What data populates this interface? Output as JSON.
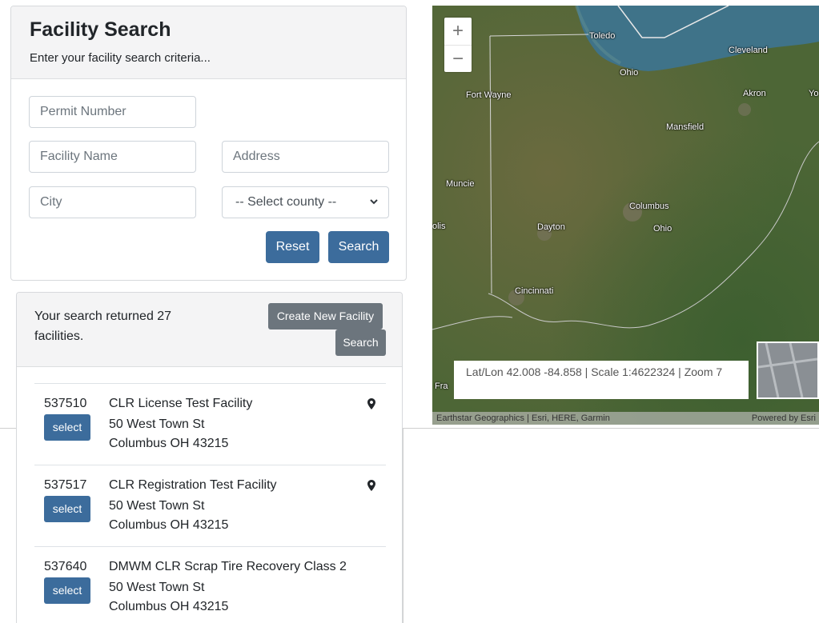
{
  "search": {
    "title": "Facility Search",
    "subtitle": "Enter your facility search criteria...",
    "permit_placeholder": "Permit Number",
    "name_placeholder": "Facility Name",
    "address_placeholder": "Address",
    "city_placeholder": "City",
    "county_selected": "-- Select county --",
    "reset_label": "Reset",
    "search_label": "Search"
  },
  "results": {
    "count_text": "Your search returned 27 facilities.",
    "create_label": "Create New Facility",
    "search_label": "Search",
    "select_label": "select",
    "rows": [
      {
        "permit": "537510",
        "name": "CLR License Test Facility",
        "address": "50 West Town St",
        "city": "Columbus OH 43215",
        "has_pin": true
      },
      {
        "permit": "537517",
        "name": "CLR Registration Test Facility",
        "address": "50 West Town St",
        "city": "Columbus OH 43215",
        "has_pin": true
      },
      {
        "permit": "537640",
        "name": "DMWM CLR Scrap Tire Recovery Class 2",
        "address": "50 West Town St",
        "city": "Columbus OH 43215",
        "has_pin": false
      }
    ]
  },
  "map": {
    "zoom_in": "+",
    "zoom_out": "−",
    "labels": [
      "Toledo",
      "Cleveland",
      "Ohio",
      "Fort Wayne",
      "Akron",
      "Yo",
      "Mansfield",
      "Muncie",
      "Columbus",
      "Ohio",
      "olis",
      "Dayton",
      "Cincinnati",
      "Fra"
    ],
    "coord_text": "Lat/Lon 42.008 -84.858 | Scale 1:4622324 | Zoom 7",
    "attribution_left": "Earthstar Geographics | Esri, HERE, Garmin",
    "attribution_right": "Powered by Esri"
  },
  "icons": {
    "pin": "map-pin-icon",
    "chevron": "chevron-down-icon"
  },
  "colors": {
    "primary_button": "#3c6c9c",
    "secondary_button": "#6c757d",
    "card_header": "#f4f4f5",
    "map_land": "#4b6a37",
    "lake": "#3f7389"
  }
}
